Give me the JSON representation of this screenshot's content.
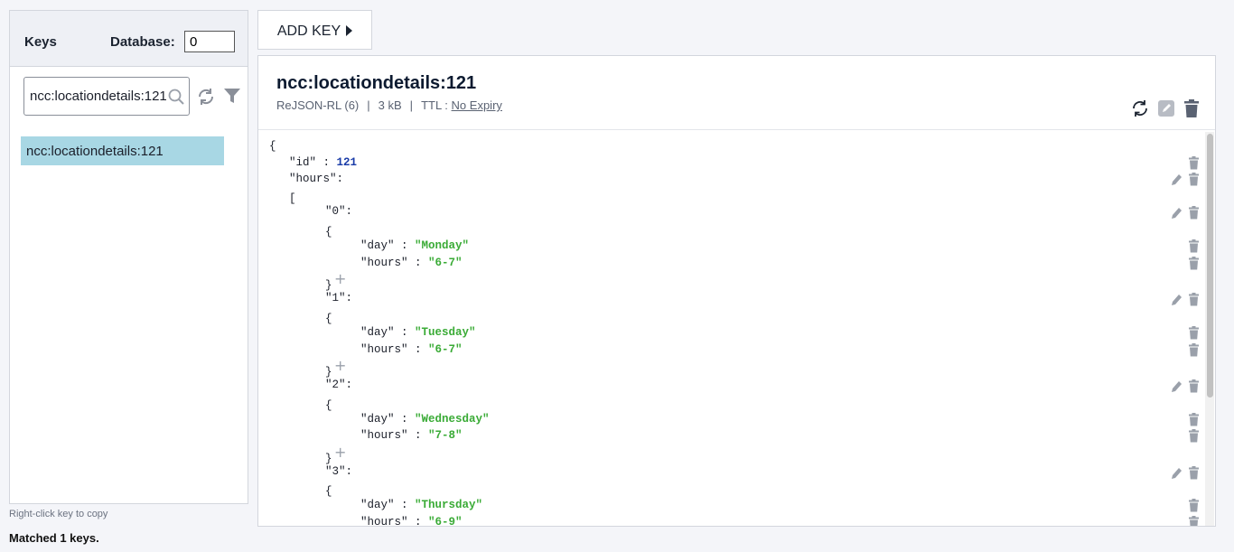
{
  "sidebar": {
    "title": "Keys",
    "database_label": "Database:",
    "database_value": "0",
    "search_value": "ncc:locationdetails:121",
    "keys": [
      "ncc:locationdetails:121"
    ],
    "hint": "Right-click key to copy",
    "matched": "Matched 1 keys."
  },
  "toolbar": {
    "add_key_label": "ADD KEY"
  },
  "detail": {
    "key_name": "ncc:locationdetails:121",
    "type": "ReJSON-RL (6)",
    "size": "3 kB",
    "ttl_label": "TTL :",
    "ttl_value": "No Expiry",
    "separator": "|"
  },
  "json_lines": [
    {
      "text": "{"
    },
    {
      "key": "\"id\"",
      "sep": " : ",
      "value": "121",
      "vtype": "num"
    },
    {
      "key": "\"hours\"",
      "sep": ":"
    },
    {
      "text": "["
    },
    {
      "key": "\"0\"",
      "sep": ":"
    },
    {
      "text": "{"
    },
    {
      "key": "\"day\"",
      "sep": " : ",
      "value": "\"Monday\"",
      "vtype": "str"
    },
    {
      "key": "\"hours\"",
      "sep": " : ",
      "value": "\"6-7\"",
      "vtype": "str"
    },
    {
      "text": "}"
    },
    {
      "key": "\"1\"",
      "sep": ":"
    },
    {
      "text": "{"
    },
    {
      "key": "\"day\"",
      "sep": " : ",
      "value": "\"Tuesday\"",
      "vtype": "str"
    },
    {
      "key": "\"hours\"",
      "sep": " : ",
      "value": "\"6-7\"",
      "vtype": "str"
    },
    {
      "text": "}"
    },
    {
      "key": "\"2\"",
      "sep": ":"
    },
    {
      "text": "{"
    },
    {
      "key": "\"day\"",
      "sep": " : ",
      "value": "\"Wednesday\"",
      "vtype": "str"
    },
    {
      "key": "\"hours\"",
      "sep": " : ",
      "value": "\"7-8\"",
      "vtype": "str"
    },
    {
      "text": "}"
    },
    {
      "key": "\"3\"",
      "sep": ":"
    },
    {
      "text": "{"
    },
    {
      "key": "\"day\"",
      "sep": " : ",
      "value": "\"Thursday\"",
      "vtype": "str"
    },
    {
      "key": "\"hours\"",
      "sep": " : ",
      "value": "\"6-9\"",
      "vtype": "str"
    }
  ],
  "icons": {
    "search": "search-icon",
    "refresh": "refresh-icon",
    "filter": "filter-icon",
    "edit": "pencil-icon",
    "delete": "trash-icon",
    "add": "plus-icon",
    "add_key_arrow": "caret-right-icon"
  },
  "colors": {
    "selected_key_bg": "#a8d7e4",
    "json_number": "#1a3ca8",
    "json_string": "#3aab36",
    "icon_gray": "#9aa0aa"
  }
}
